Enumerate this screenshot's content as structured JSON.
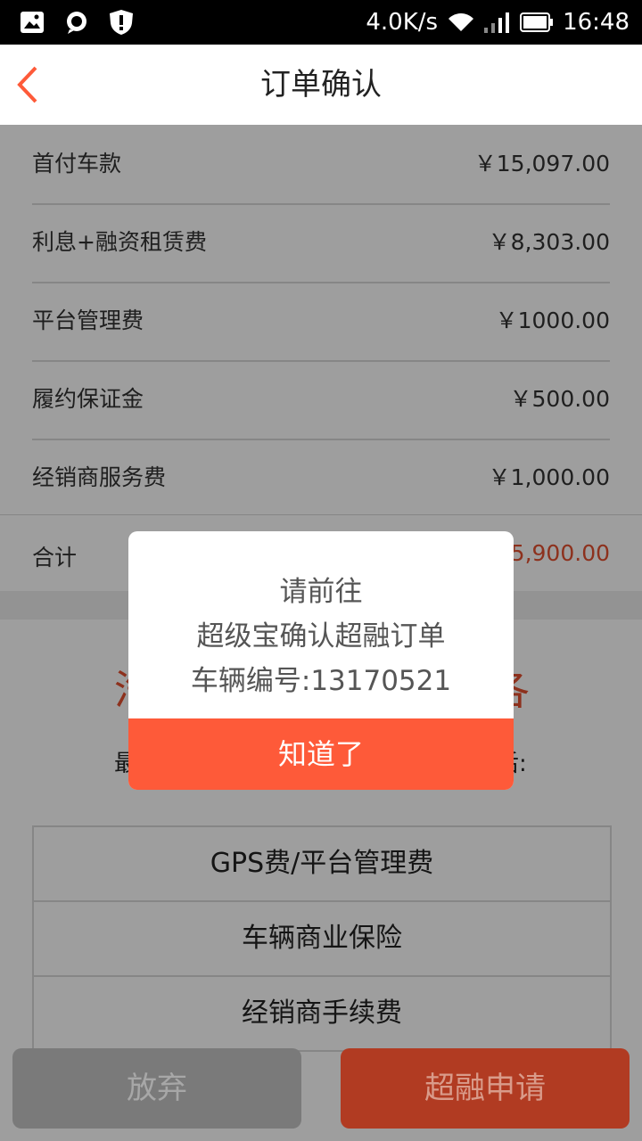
{
  "status_bar": {
    "speed": "4.0K/s",
    "time": "16:48"
  },
  "header": {
    "title": "订单确认"
  },
  "fees": [
    {
      "label": "首付车款",
      "value": "￥15,097.00"
    },
    {
      "label": "利息+融资租赁费",
      "value": "￥8,303.00"
    },
    {
      "label": "平台管理费",
      "value": "￥1000.00"
    },
    {
      "label": "履约保证金",
      "value": "￥500.00"
    },
    {
      "label": "经销商服务费",
      "value": "￥1,000.00"
    }
  ],
  "total": {
    "label": "合计",
    "value_visible": "5,900.00"
  },
  "background": {
    "big_left": "汽",
    "big_right": "各",
    "sub_left": "最",
    "sub_right": "后:"
  },
  "fee_items": [
    "GPS费/平台管理费",
    "车辆商业保险",
    "经销商手续费"
  ],
  "buttons": {
    "give_up": "放弃",
    "apply": "超融申请"
  },
  "dialog": {
    "line1": "请前往",
    "line2": "超级宝确认超融订单",
    "line3": "车辆编号:13170521",
    "confirm": "知道了"
  },
  "colors": {
    "accent": "#fe5a39",
    "price_red": "#e4502f"
  }
}
